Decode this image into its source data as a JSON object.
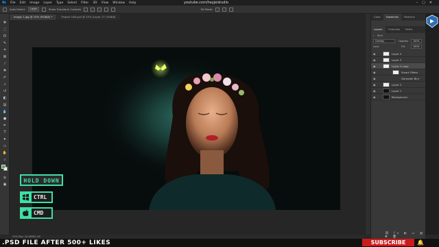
{
  "menubar": {
    "items": [
      "File",
      "Edit",
      "Image",
      "Layer",
      "Type",
      "Select",
      "Filter",
      "3D",
      "View",
      "Window",
      "Help"
    ],
    "url": "youtube.com/heyjeistudio"
  },
  "optbar": {
    "auto_select_label": "Auto-Select:",
    "auto_select_value": "Layer",
    "transform_label": "Show Transform Controls",
    "mode_label": "3D Mode:"
  },
  "tabs": [
    {
      "label": "Image 1.jpg @ 25% (RGB/8) *",
      "active": true
    },
    {
      "label": "Project 108.psd @ 25% (Layer 17, RGB/8)",
      "active": false
    }
  ],
  "status": {
    "text": "25%     Doc: 24.9M/52.1M"
  },
  "panel": {
    "top_tabs": [
      "Color",
      "Swatches",
      "Patterns"
    ],
    "layer_tabs": [
      "Layers",
      "Channels",
      "Paths"
    ],
    "kind_label": "Kind",
    "blend_mode": "Overlay",
    "opacity_label": "Opacity:",
    "opacity_value": "100%",
    "lock_label": "Lock:",
    "fill_label": "Fill:",
    "fill_value": "100%",
    "layers": [
      {
        "name": "Layer 4",
        "thumb": "light",
        "sub": false,
        "selected": false
      },
      {
        "name": "Layer 3",
        "thumb": "light",
        "sub": false,
        "selected": false
      },
      {
        "name": "Layer 2 copy",
        "thumb": "light",
        "sub": false,
        "selected": true
      },
      {
        "name": "Smart Filters",
        "thumb": "light",
        "sub": true,
        "selected": false
      },
      {
        "name": "Gaussian Blur",
        "thumb": "none",
        "sub": true,
        "selected": false
      },
      {
        "name": "Layer 2",
        "thumb": "light",
        "sub": false,
        "selected": false
      },
      {
        "name": "Layer 1",
        "thumb": "dark",
        "sub": false,
        "selected": false
      },
      {
        "name": "Background",
        "thumb": "dark",
        "sub": false,
        "selected": false
      }
    ]
  },
  "overlay": {
    "hold_down": "HOLD DOWN",
    "ctrl_label": "CTRL",
    "cmd_label": "CMD",
    "psd_text": ".PSD FILE AFTER 500+ LIKES",
    "subscribe": "SUBSCRIBE"
  },
  "colors": {
    "accent": "#3de0a6",
    "subscribe_red": "#cc1b1b",
    "foreground_swatch": "#4cae4c"
  },
  "icons": {
    "windows_key": "windows-logo-icon",
    "mac_key": "apple-logo-icon",
    "notification": "bell-icon"
  }
}
